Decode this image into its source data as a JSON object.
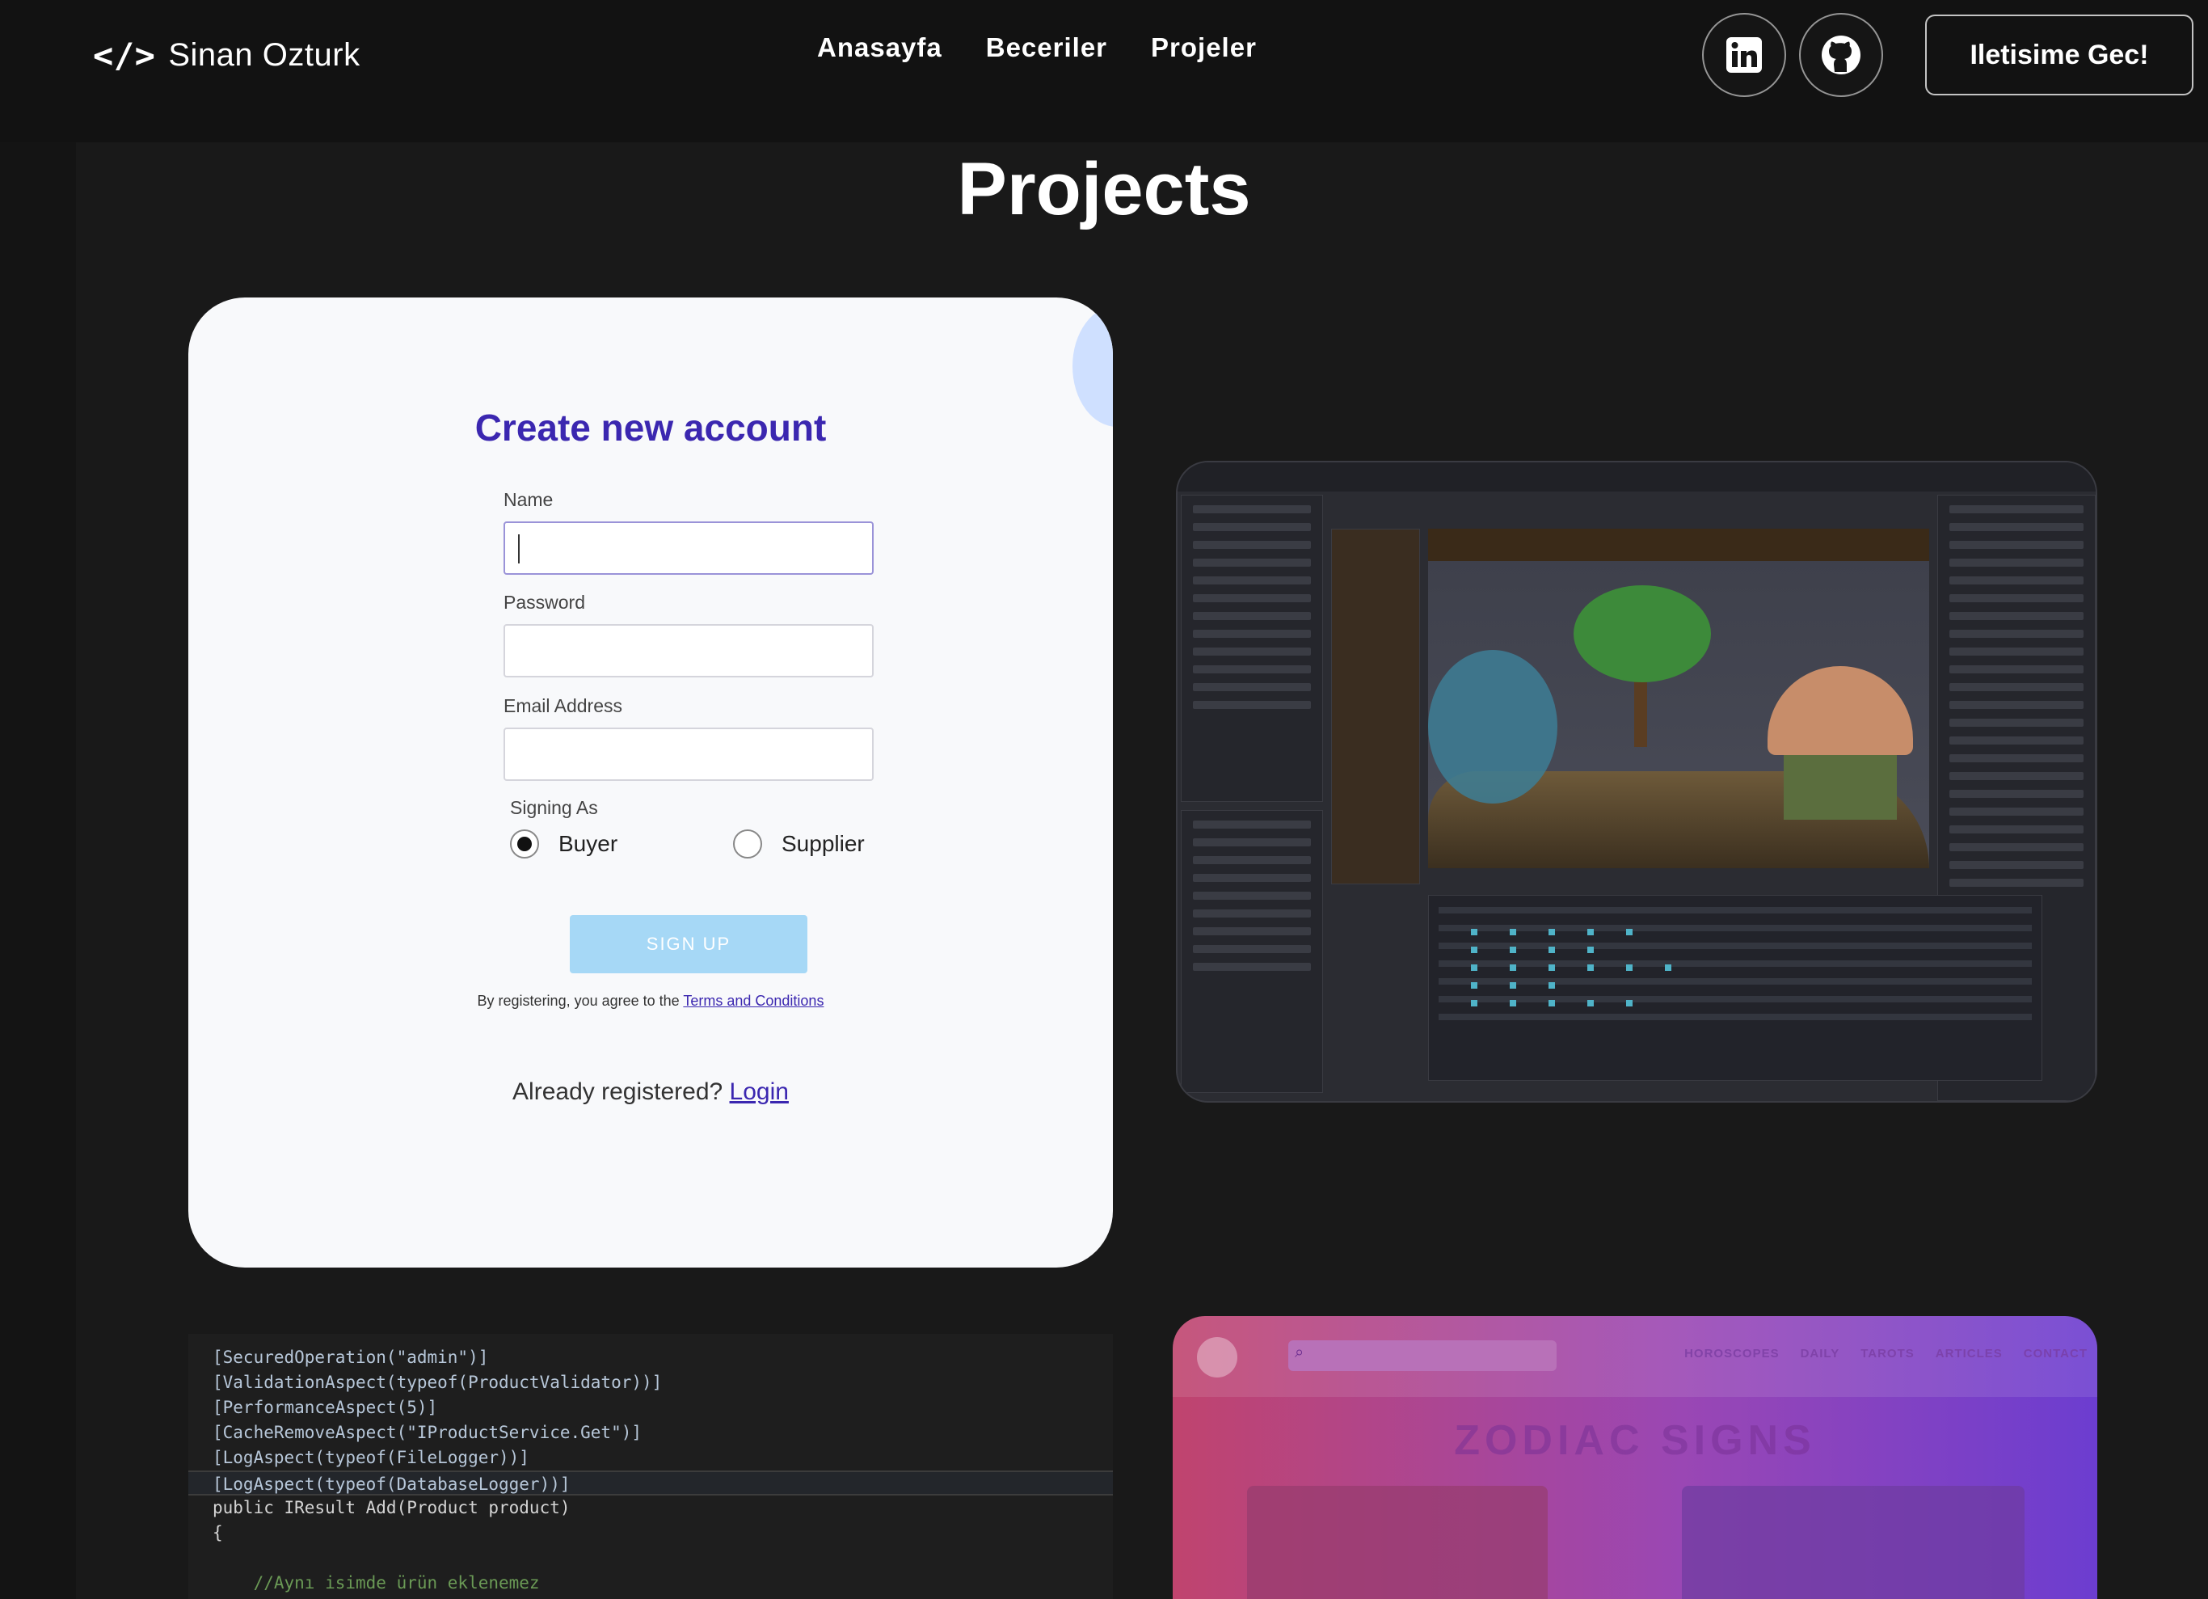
{
  "brand": {
    "icon": "code-icon",
    "glyph": "</>",
    "name": "Sinan Ozturk"
  },
  "nav": {
    "links": [
      "Anasayfa",
      "Beceriler",
      "Projeler"
    ]
  },
  "social": {
    "linkedin_icon": "linkedin-icon",
    "github_icon": "github-icon"
  },
  "cta": {
    "label": "Iletisime Gec!"
  },
  "section": {
    "title": "Projects"
  },
  "signup": {
    "title": "Create new account",
    "name_label": "Name",
    "password_label": "Password",
    "email_label": "Email Address",
    "signing_as_label": "Signing As",
    "options": [
      {
        "label": "Buyer",
        "selected": true
      },
      {
        "label": "Supplier",
        "selected": false
      }
    ],
    "button": "SIGN UP",
    "terms_prefix": "By registering, you agree to the ",
    "terms_link": "Terms and Conditions",
    "already_prefix": "Already registered? ",
    "login_link": "Login"
  },
  "code": {
    "lines": [
      "[SecuredOperation(\"admin\")]",
      "[ValidationAspect(typeof(ProductValidator))]",
      "[PerformanceAspect(5)]",
      "[CacheRemoveAspect(\"IProductService.Get\")]",
      "[LogAspect(typeof(FileLogger))]",
      "[LogAspect(typeof(DatabaseLogger))]",
      "public IResult Add(Product product)",
      "{",
      "",
      "    //Aynı isimde ürün eklenemez"
    ]
  },
  "zodiac": {
    "nav": [
      "HOROSCOPES",
      "DAILY",
      "TAROTS",
      "ARTICLES",
      "CONTACT"
    ],
    "title": "ZODIAC SIGNS"
  }
}
